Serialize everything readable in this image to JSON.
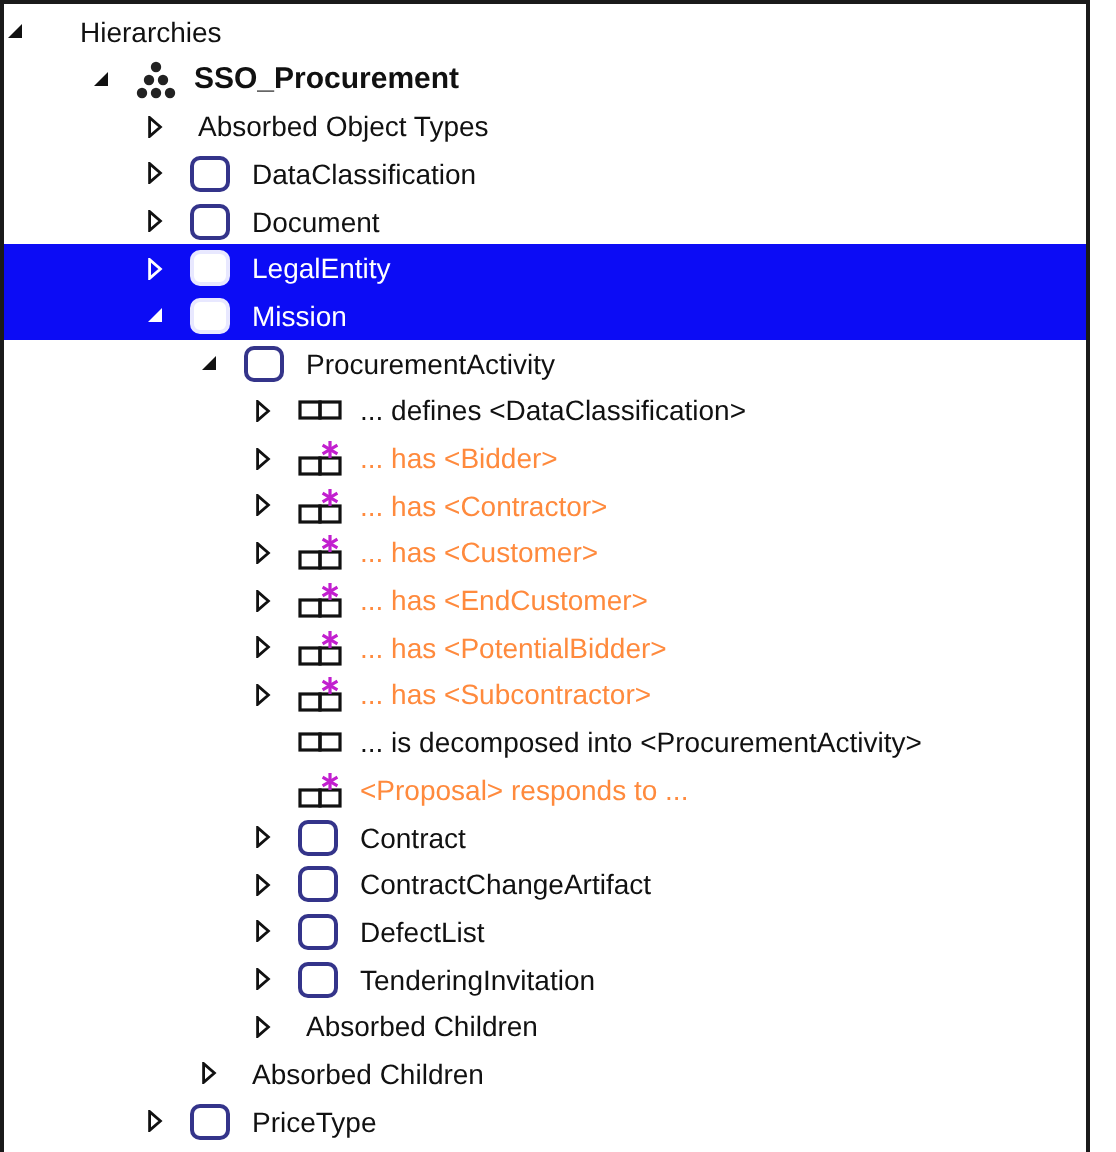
{
  "tree": [
    {
      "label": "Hierarchies",
      "kind": "group",
      "expanded": true,
      "selected": false,
      "children": [
        {
          "label": "SSO_Procurement",
          "kind": "model",
          "expanded": true,
          "selected": false,
          "children": [
            {
              "label": "Absorbed Object Types",
              "kind": "group",
              "expanded": false,
              "selected": false
            },
            {
              "label": "DataClassification",
              "kind": "object",
              "expanded": false,
              "selected": false
            },
            {
              "label": "Document",
              "kind": "object",
              "expanded": false,
              "selected": false
            },
            {
              "label": "LegalEntity",
              "kind": "object",
              "expanded": false,
              "selected": true
            },
            {
              "label": "Mission",
              "kind": "object",
              "expanded": true,
              "selected": true,
              "children": [
                {
                  "label": "ProcurementActivity",
                  "kind": "object",
                  "expanded": true,
                  "selected": false,
                  "children": [
                    {
                      "label": "... defines <DataClassification>",
                      "kind": "fact",
                      "expanded": false,
                      "selected": false
                    },
                    {
                      "label": "... has <Bidder>",
                      "kind": "derived-fact",
                      "expanded": false,
                      "selected": false
                    },
                    {
                      "label": "... has <Contractor>",
                      "kind": "derived-fact",
                      "expanded": false,
                      "selected": false
                    },
                    {
                      "label": "... has <Customer>",
                      "kind": "derived-fact",
                      "expanded": false,
                      "selected": false
                    },
                    {
                      "label": "... has <EndCustomer>",
                      "kind": "derived-fact",
                      "expanded": false,
                      "selected": false
                    },
                    {
                      "label": "... has <PotentialBidder>",
                      "kind": "derived-fact",
                      "expanded": false,
                      "selected": false
                    },
                    {
                      "label": "... has <Subcontractor>",
                      "kind": "derived-fact",
                      "expanded": false,
                      "selected": false
                    },
                    {
                      "label": "... is decomposed into <ProcurementActivity>",
                      "kind": "fact",
                      "selected": false
                    },
                    {
                      "label": "<Proposal> responds to ...",
                      "kind": "derived-fact",
                      "selected": false
                    },
                    {
                      "label": "Contract",
                      "kind": "object",
                      "expanded": false,
                      "selected": false
                    },
                    {
                      "label": "ContractChangeArtifact",
                      "kind": "object",
                      "expanded": false,
                      "selected": false
                    },
                    {
                      "label": "DefectList",
                      "kind": "object",
                      "expanded": false,
                      "selected": false
                    },
                    {
                      "label": "TenderingInvitation",
                      "kind": "object",
                      "expanded": false,
                      "selected": false
                    },
                    {
                      "label": "Absorbed Children",
                      "kind": "group",
                      "expanded": false,
                      "selected": false
                    }
                  ]
                },
                {
                  "label": "Absorbed Children",
                  "kind": "group",
                  "expanded": false,
                  "selected": false
                }
              ]
            },
            {
              "label": "PriceType",
              "kind": "object",
              "expanded": false,
              "selected": false
            }
          ]
        }
      ]
    }
  ]
}
